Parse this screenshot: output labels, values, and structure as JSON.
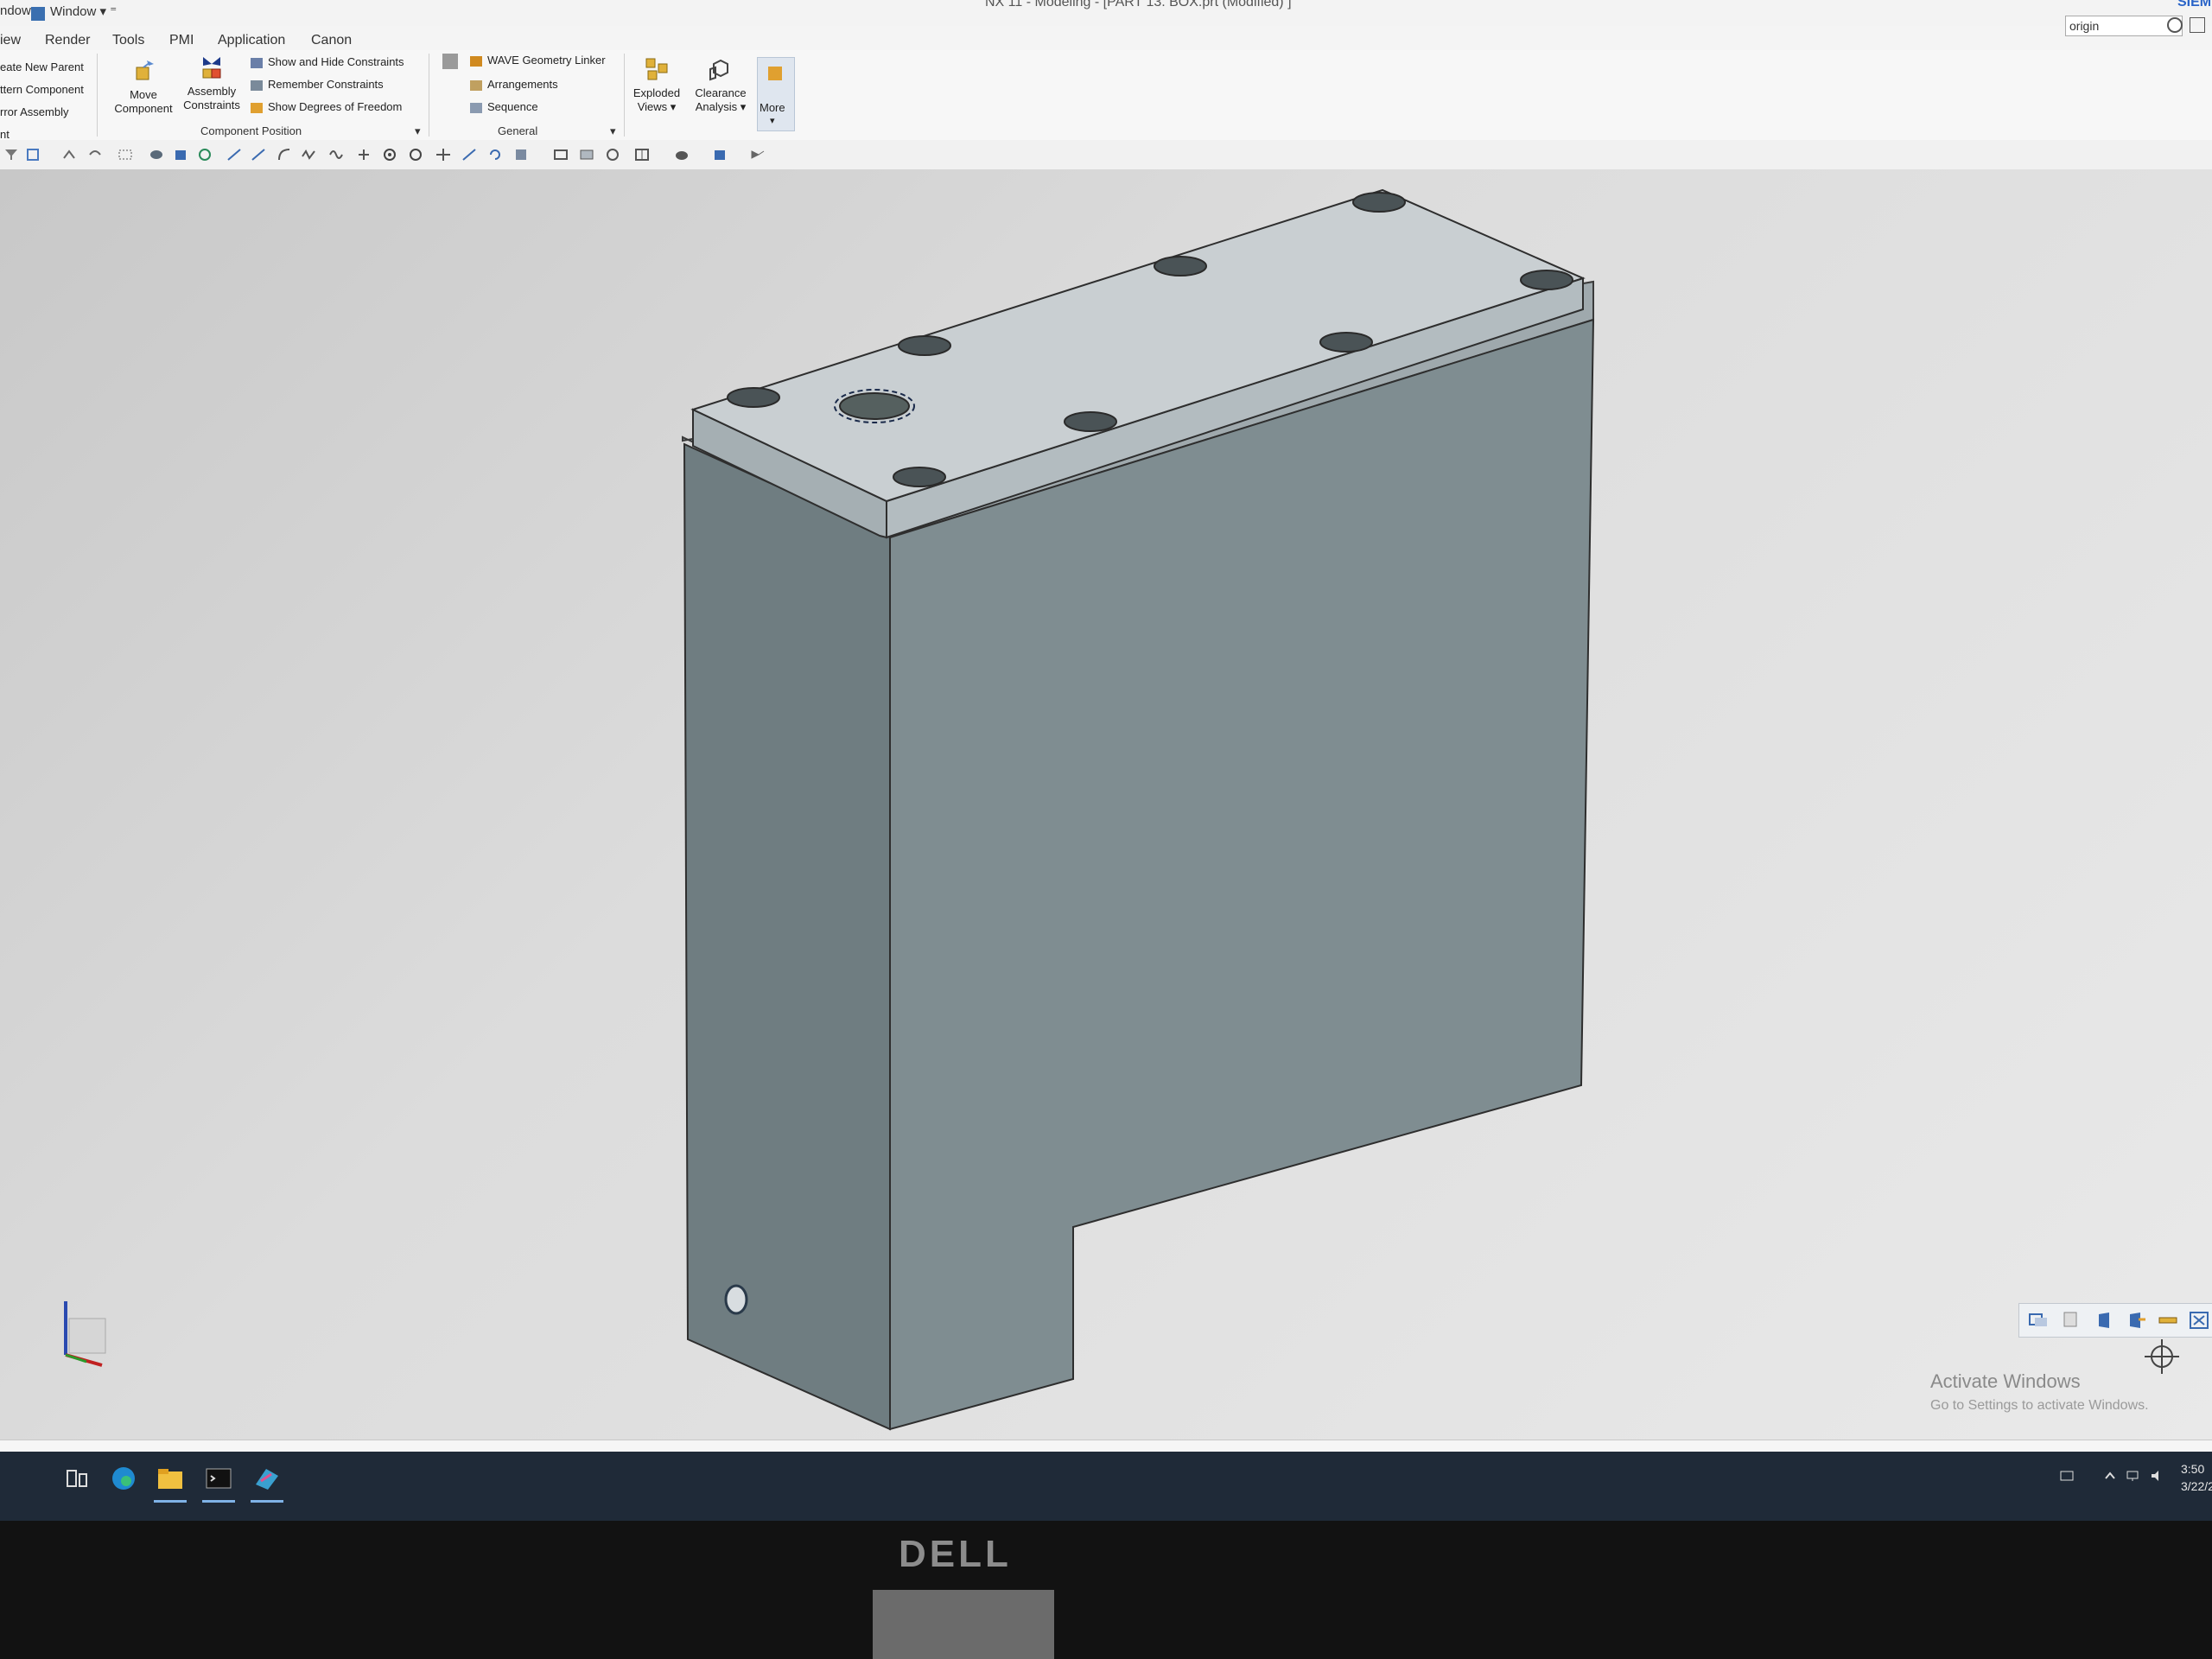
{
  "titlebar": {
    "left_text": "ndow",
    "window_menu": "Window ▾ ⁼",
    "app_title": "NX 11 - Modeling - [PART 13. BOX.prt (Modified) ]",
    "brand": "SIEM"
  },
  "menu": {
    "tabs": [
      "iew",
      "Render",
      "Tools",
      "PMI",
      "Application",
      "Canon"
    ]
  },
  "search": {
    "value": "origin"
  },
  "ribbon": {
    "assembly_left": [
      "eate New Parent",
      "ttern Component",
      "rror Assembly",
      "nt"
    ],
    "move_component": "Move\nComponent",
    "move_component_l1": "Move",
    "move_component_l2": "Component",
    "assembly_constraints_l1": "Assembly",
    "assembly_constraints_l2": "Constraints",
    "constraints": [
      "Show and Hide Constraints",
      "Remember Constraints",
      "Show Degrees of Freedom"
    ],
    "group_component_position": "Component Position",
    "general_items": [
      "WAVE Geometry Linker",
      "Arrangements",
      "Sequence"
    ],
    "group_general": "General",
    "exploded_l1": "Exploded",
    "exploded_l2": "Views ▾",
    "clearance_l1": "Clearance",
    "clearance_l2": "Analysis ▾",
    "more": "More"
  },
  "watermark": {
    "title": "Activate Windows",
    "subtitle": "Go to Settings to activate Windows."
  },
  "clock": {
    "time": "3:50",
    "date": "3/22/2"
  },
  "monitor": {
    "brand": "DELL"
  },
  "colors": {
    "model_top": "#c9cfd2",
    "model_front": "#7f8d90",
    "model_side": "#6e7c80",
    "taskbar": "#1f2a38"
  }
}
